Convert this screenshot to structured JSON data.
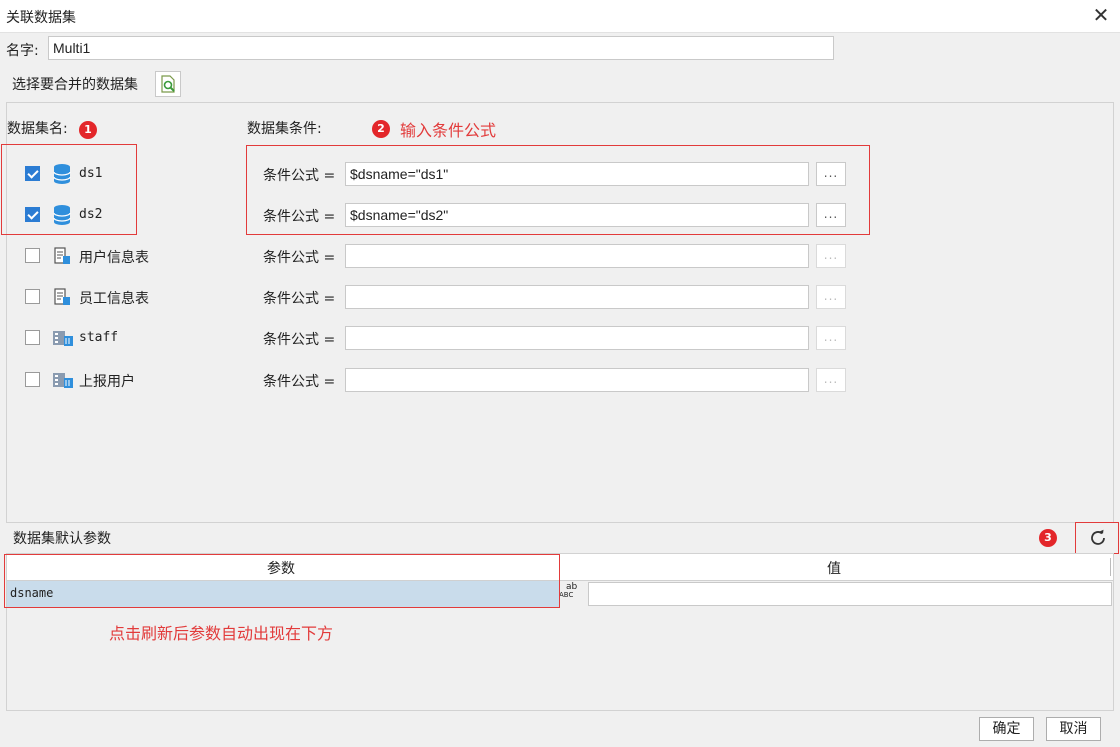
{
  "window": {
    "title": "关联数据集",
    "close_label": "✕"
  },
  "name_row": {
    "label": "名字:",
    "value": "Multi1"
  },
  "select_row": {
    "label": "选择要合并的数据集"
  },
  "columns": {
    "dataset_name": "数据集名:",
    "condition": "数据集条件:"
  },
  "annotations": {
    "badge1": "1",
    "badge2": "2",
    "badge3": "3",
    "note2": "输入条件公式",
    "note_bottom": "点击刷新后参数自动出现在下方"
  },
  "datasets": [
    {
      "name": "ds1",
      "checked": true,
      "icon": "database-icon",
      "formula_label": "条件公式 =",
      "formula": "$dsname=\"ds1\"",
      "dots": "..."
    },
    {
      "name": "ds2",
      "checked": true,
      "icon": "database-icon",
      "formula_label": "条件公式 =",
      "formula": "$dsname=\"ds2\"",
      "dots": "..."
    },
    {
      "name": "用户信息表",
      "checked": false,
      "icon": "table-icon",
      "formula_label": "条件公式 =",
      "formula": "",
      "dots": "..."
    },
    {
      "name": "员工信息表",
      "checked": false,
      "icon": "table-icon",
      "formula_label": "条件公式 =",
      "formula": "",
      "dots": "..."
    },
    {
      "name": "staff",
      "checked": false,
      "icon": "server-icon",
      "formula_label": "条件公式 =",
      "formula": "",
      "dots": "..."
    },
    {
      "name": "上报用户",
      "checked": false,
      "icon": "server-icon",
      "formula_label": "条件公式 =",
      "formula": "",
      "dots": "..."
    }
  ],
  "params": {
    "label": "数据集默认参数",
    "header_param": "参数",
    "header_value": "值",
    "rows": [
      {
        "param": "dsname",
        "type_icon": "ABC",
        "value": ""
      }
    ]
  },
  "footer": {
    "ok": "确定",
    "cancel": "取消"
  },
  "colors": {
    "accent": "#2b7cd3",
    "annotation": "#e23b3b",
    "selected_row": "#c9dceb"
  }
}
